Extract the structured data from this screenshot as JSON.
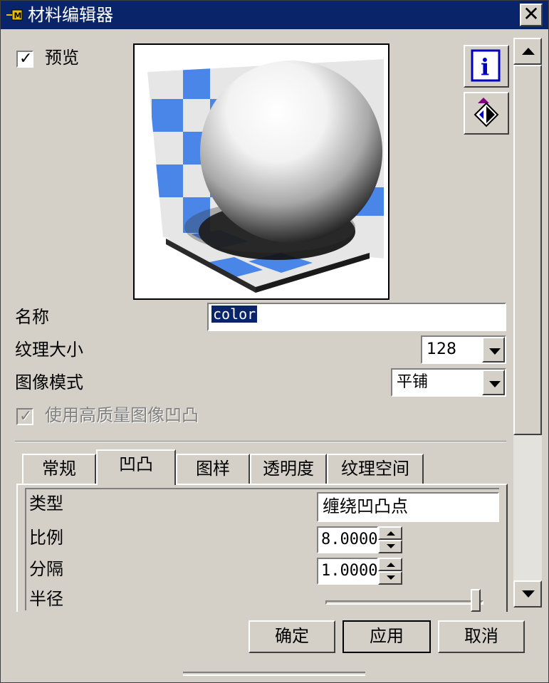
{
  "window": {
    "title": "材料编辑器",
    "close_glyph": "✕",
    "icon": "app-icon"
  },
  "preview": {
    "checkbox_label": "预览",
    "checked": true
  },
  "side_buttons": [
    {
      "icon": "info-icon",
      "glyph": "i"
    },
    {
      "icon": "material-flip-icon"
    }
  ],
  "fields": {
    "name_label": "名称",
    "name_value": "color",
    "texture_size_label": "纹理大小",
    "texture_size_value": "128",
    "image_mode_label": "图像模式",
    "image_mode_value": "平铺",
    "hq_bump_label": "使用高质量图像凹凸",
    "hq_bump_checked": true,
    "hq_bump_disabled": true
  },
  "tabs": [
    {
      "label": "常规"
    },
    {
      "label": "凹凸",
      "active": true
    },
    {
      "label": "图样"
    },
    {
      "label": "透明度"
    },
    {
      "label": "纹理空间"
    }
  ],
  "bump_panel": {
    "type_label": "类型",
    "type_value": "缠绕凹凸点",
    "scale_label": "比例",
    "scale_value": "8.0000",
    "spacing_label": "分隔",
    "spacing_value": "1.0000",
    "radius_label": "半径",
    "radius_level": 1.0
  },
  "buttons": {
    "ok": "确定",
    "apply": "应用",
    "cancel": "取消"
  },
  "colors": {
    "titlebar": "#0a246a",
    "face": "#d4d0c8",
    "checker_blue": "#4a86e8",
    "selection": "#0a246a"
  }
}
